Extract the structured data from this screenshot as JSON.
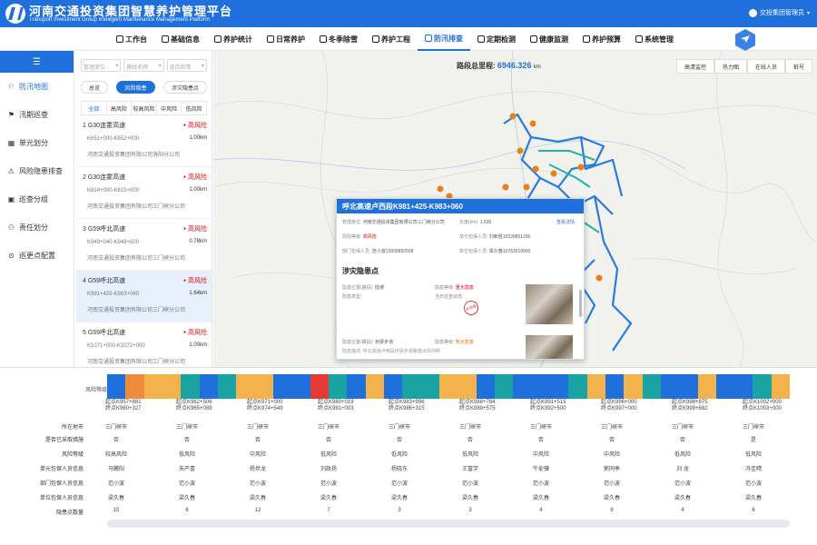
{
  "header": {
    "title_cn": "河南交通投资集团智慧养护管理平台",
    "title_en": "Transport Investment Group Intelligent Maintenance Management Platform",
    "user": "交投集团管理员"
  },
  "nav": [
    "工作台",
    "基础信息",
    "养护统计",
    "日常养护",
    "冬季除雪",
    "养护工程",
    "防汛排查",
    "定期检测",
    "健康监测",
    "养护预算",
    "系统管理"
  ],
  "nav_active": 6,
  "sidebar": {
    "items": [
      "防汛地图",
      "汛期巡查",
      "单元划分",
      "风险隐患排查",
      "巡查分组",
      "责任划分",
      "巡更点配置"
    ],
    "active": 0
  },
  "filters": [
    "管理单位",
    "路线名称",
    "选风险等"
  ],
  "modes": [
    "总览",
    "风险隐患",
    "涉灾隐患点"
  ],
  "risk_tabs": [
    "全部",
    "高风险",
    "较高风险",
    "中风险",
    "低风险"
  ],
  "segments": [
    {
      "title": "1 G30连霍高速",
      "risk": "高风险",
      "range": "K651+000-K652+000",
      "length": "1.00km",
      "company": "河南交通投资集团有限公司洛阳分公司"
    },
    {
      "title": "2 G30连霍高速",
      "risk": "高风险",
      "range": "K814+000-K815+000",
      "length": "1.00km",
      "company": "河南交通投资集团有限公司三门峡分公司"
    },
    {
      "title": "3 G59呼北高速",
      "risk": "高风险",
      "range": "K949+040-K949+820",
      "length": "0.78km",
      "company": "河南交通投资集团有限公司三门峡分公司"
    },
    {
      "title": "4 G59呼北高速",
      "risk": "高风险",
      "range": "K981+425-K983+060",
      "length": "1.64km",
      "company": "河南交通投资集团有限公司三门峡分公司"
    },
    {
      "title": "5 G59呼北高速",
      "risk": "高风险",
      "range": "K1071+000-K1072+000",
      "length": "1.00km",
      "company": "河南交通投资集团有限公司三门峡分公司"
    }
  ],
  "active_segment": 3,
  "map": {
    "total_label": "路段总里程:",
    "total_value": "6946.326",
    "total_unit": "km",
    "tools": [
      "高清监控",
      "热力图",
      "在线人员",
      "桩号"
    ]
  },
  "popup": {
    "title": "呼北高速卢西段K981+425-K983+060",
    "detail_link": "查看详情",
    "mgmt_unit_k": "管理单位:",
    "mgmt_unit_v": "河南交通投资集团有限公司三门峡分公司",
    "length_k": "长度(km):",
    "length_v": "1.635",
    "risk_k": "风险等级:",
    "risk_v": "高风险",
    "unit_person_k": "单元包保人员:",
    "unit_person_v": "刘新胜15539851290",
    "dept_person_k": "部门包保人员:",
    "dept_person_v": "范小波13939892508",
    "site_person_k": "单位包保人员:",
    "site_person_v": "梁久春13763619000",
    "hazard_title": "涉灾隐患点",
    "hazards": [
      {
        "pos_k": "隐患位置(路段):",
        "pos_v": "陆坡",
        "level_k": "隐患等级:",
        "level_v": "重大隐患",
        "type_k": "隐患类型:",
        "status_k": "当日巡查状态:",
        "stamp": "未巡查"
      },
      {
        "pos_k": "隐患位置(路段):",
        "pos_v": "桥梁步道",
        "level_k": "隐患等级:",
        "level_v": "较大隐患",
        "note": "隐患描述: 呼北高速卢西段桥梁步道路基出现冲刷"
      }
    ]
  },
  "bottom": {
    "risk_label": "风险等级",
    "columns": [
      {
        "s": "起点K957+881",
        "e": "终点K960+327"
      },
      {
        "s": "起点K962+506",
        "e": "终点K965+089"
      },
      {
        "s": "起点K971+000",
        "e": "终点K974+549"
      },
      {
        "s": "起点K980+019",
        "e": "终点K981+003"
      },
      {
        "s": "起点K983+996",
        "e": "终点K986+315"
      },
      {
        "s": "起点K988+784",
        "e": "终点K989+575"
      },
      {
        "s": "起点K991+515",
        "e": "终点K992+500"
      },
      {
        "s": "起点K996+000",
        "e": "终点K997+000"
      },
      {
        "s": "起点K998+875",
        "e": "终点K999+682"
      },
      {
        "s": "起点K1002+000",
        "e": "终点K1003+000"
      }
    ],
    "row_labels": [
      "所在地市",
      "是否已采取措施",
      "风险等级",
      "单元包保人员信息",
      "部门包保人员信息",
      "单位包保人员信息",
      "隐患点数量"
    ],
    "rows": [
      [
        "三门峡市",
        "三门峡市",
        "三门峡市",
        "三门峡市",
        "三门峡市",
        "三门峡市",
        "三门峡市",
        "三门峡市",
        "三门峡市",
        "三门峡市"
      ],
      [
        "否",
        "否",
        "否",
        "否",
        "否",
        "否",
        "否",
        "否",
        "否",
        "是"
      ],
      [
        "较高风险",
        "低风险",
        "中风险",
        "低风险",
        "低风险",
        "低风险",
        "中风险",
        "中风险",
        "低风险",
        "低风险"
      ],
      [
        "马騰阳",
        "朱产喜",
        "杨世龙",
        "刘政扬",
        "杨晓东",
        "王富学",
        "牛俞骥",
        "郭同季",
        "刘 龙",
        "冯佳晴"
      ],
      [
        "范小波",
        "范小波",
        "范小波",
        "范小波",
        "范小波",
        "范小波",
        "范小波",
        "范小波",
        "范小波",
        "范小波"
      ],
      [
        "梁久春",
        "梁久春",
        "梁久春",
        "梁久春",
        "梁久春",
        "梁久春",
        "梁久春",
        "梁久春",
        "梁久春",
        "梁久春"
      ],
      [
        "15",
        "6",
        "12",
        "7",
        "3",
        "3",
        "4",
        "8",
        "4",
        "6"
      ]
    ],
    "colors": {
      "high": "#e53935",
      "higher": "#f08a3c",
      "mid": "#f2b24c",
      "low": "#1f6fdc",
      "teal": "#1aa3a3"
    }
  }
}
